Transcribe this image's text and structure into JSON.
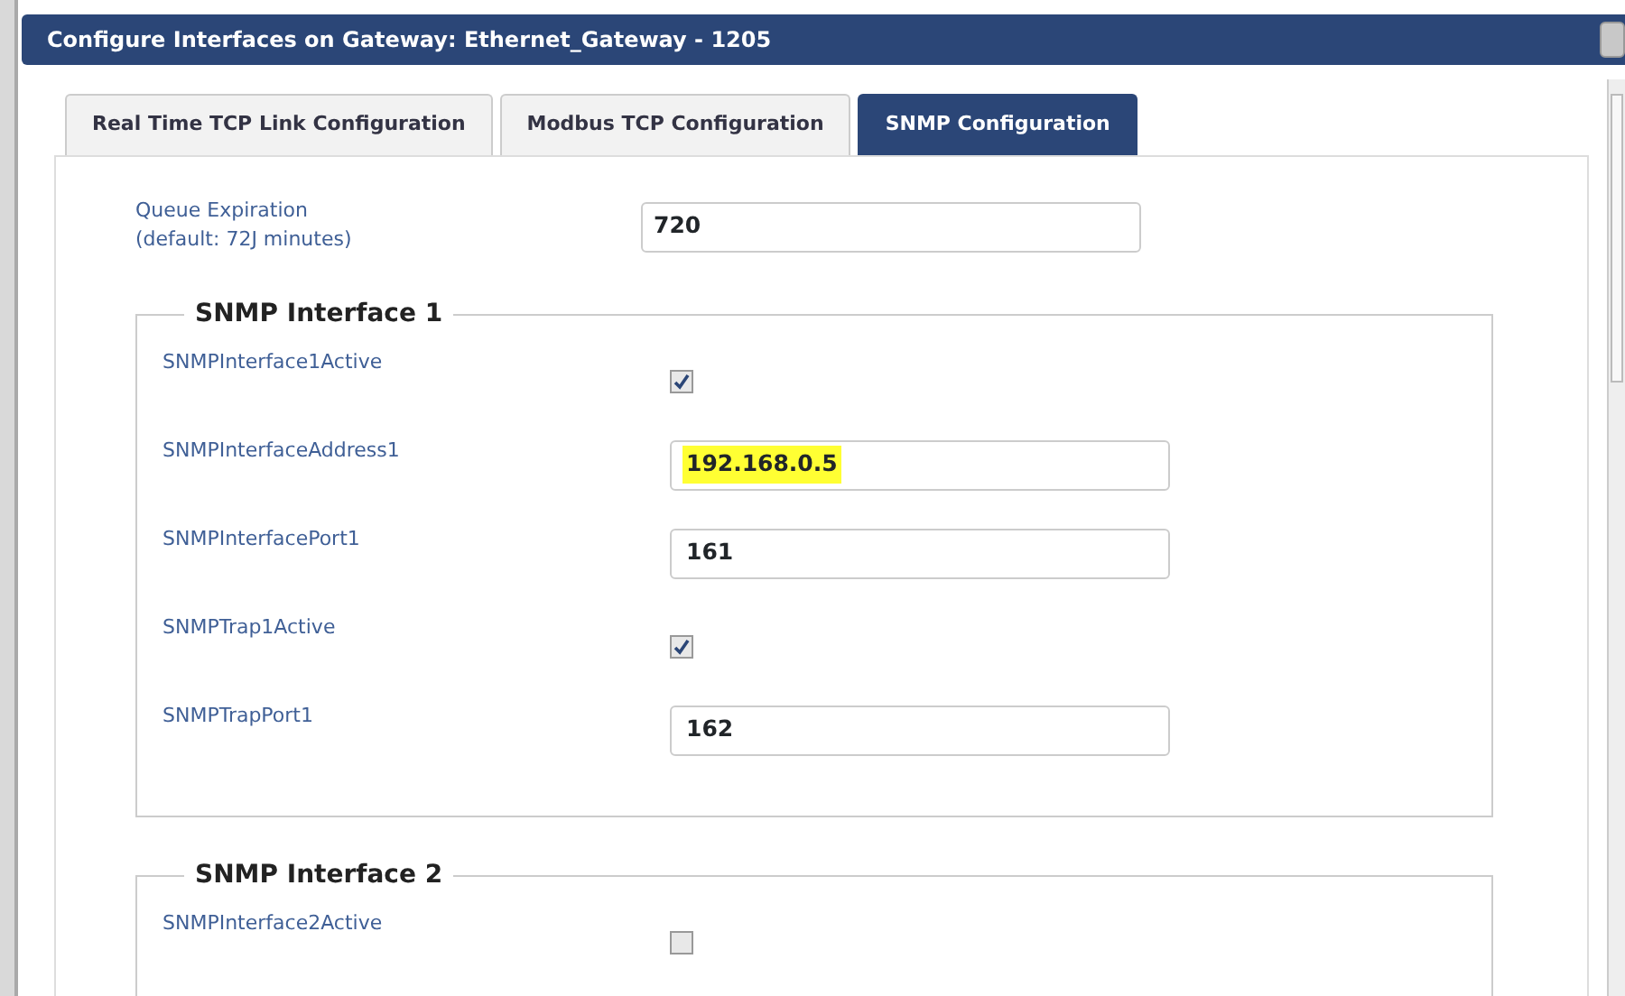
{
  "window": {
    "title": "Configure Interfaces on Gateway: Ethernet_Gateway - 1205"
  },
  "tabs": [
    {
      "label": "Real Time TCP Link Configuration",
      "selected": false
    },
    {
      "label": "Modbus TCP Configuration",
      "selected": false
    },
    {
      "label": "SNMP Configuration",
      "selected": true
    }
  ],
  "queue": {
    "label": "Queue Expiration",
    "hint": "(default: 72J minutes)",
    "value": "720"
  },
  "sections": [
    {
      "title": "SNMP Interface 1",
      "rows": [
        {
          "kind": "checkbox",
          "label": "SNMPInterface1Active",
          "checked": true
        },
        {
          "kind": "text",
          "label": "SNMPInterfaceAddress1",
          "value": "192.168.0.5",
          "highlighted": true
        },
        {
          "kind": "text",
          "label": "SNMPInterfacePort1",
          "value": "161",
          "highlighted": false
        },
        {
          "kind": "checkbox",
          "label": "SNMPTrap1Active",
          "checked": true
        },
        {
          "kind": "text",
          "label": "SNMPTrapPort1",
          "value": "162",
          "highlighted": false
        }
      ]
    },
    {
      "title": "SNMP Interface 2",
      "rows": [
        {
          "kind": "checkbox",
          "label": "SNMPInterface2Active",
          "checked": false
        }
      ]
    }
  ]
}
